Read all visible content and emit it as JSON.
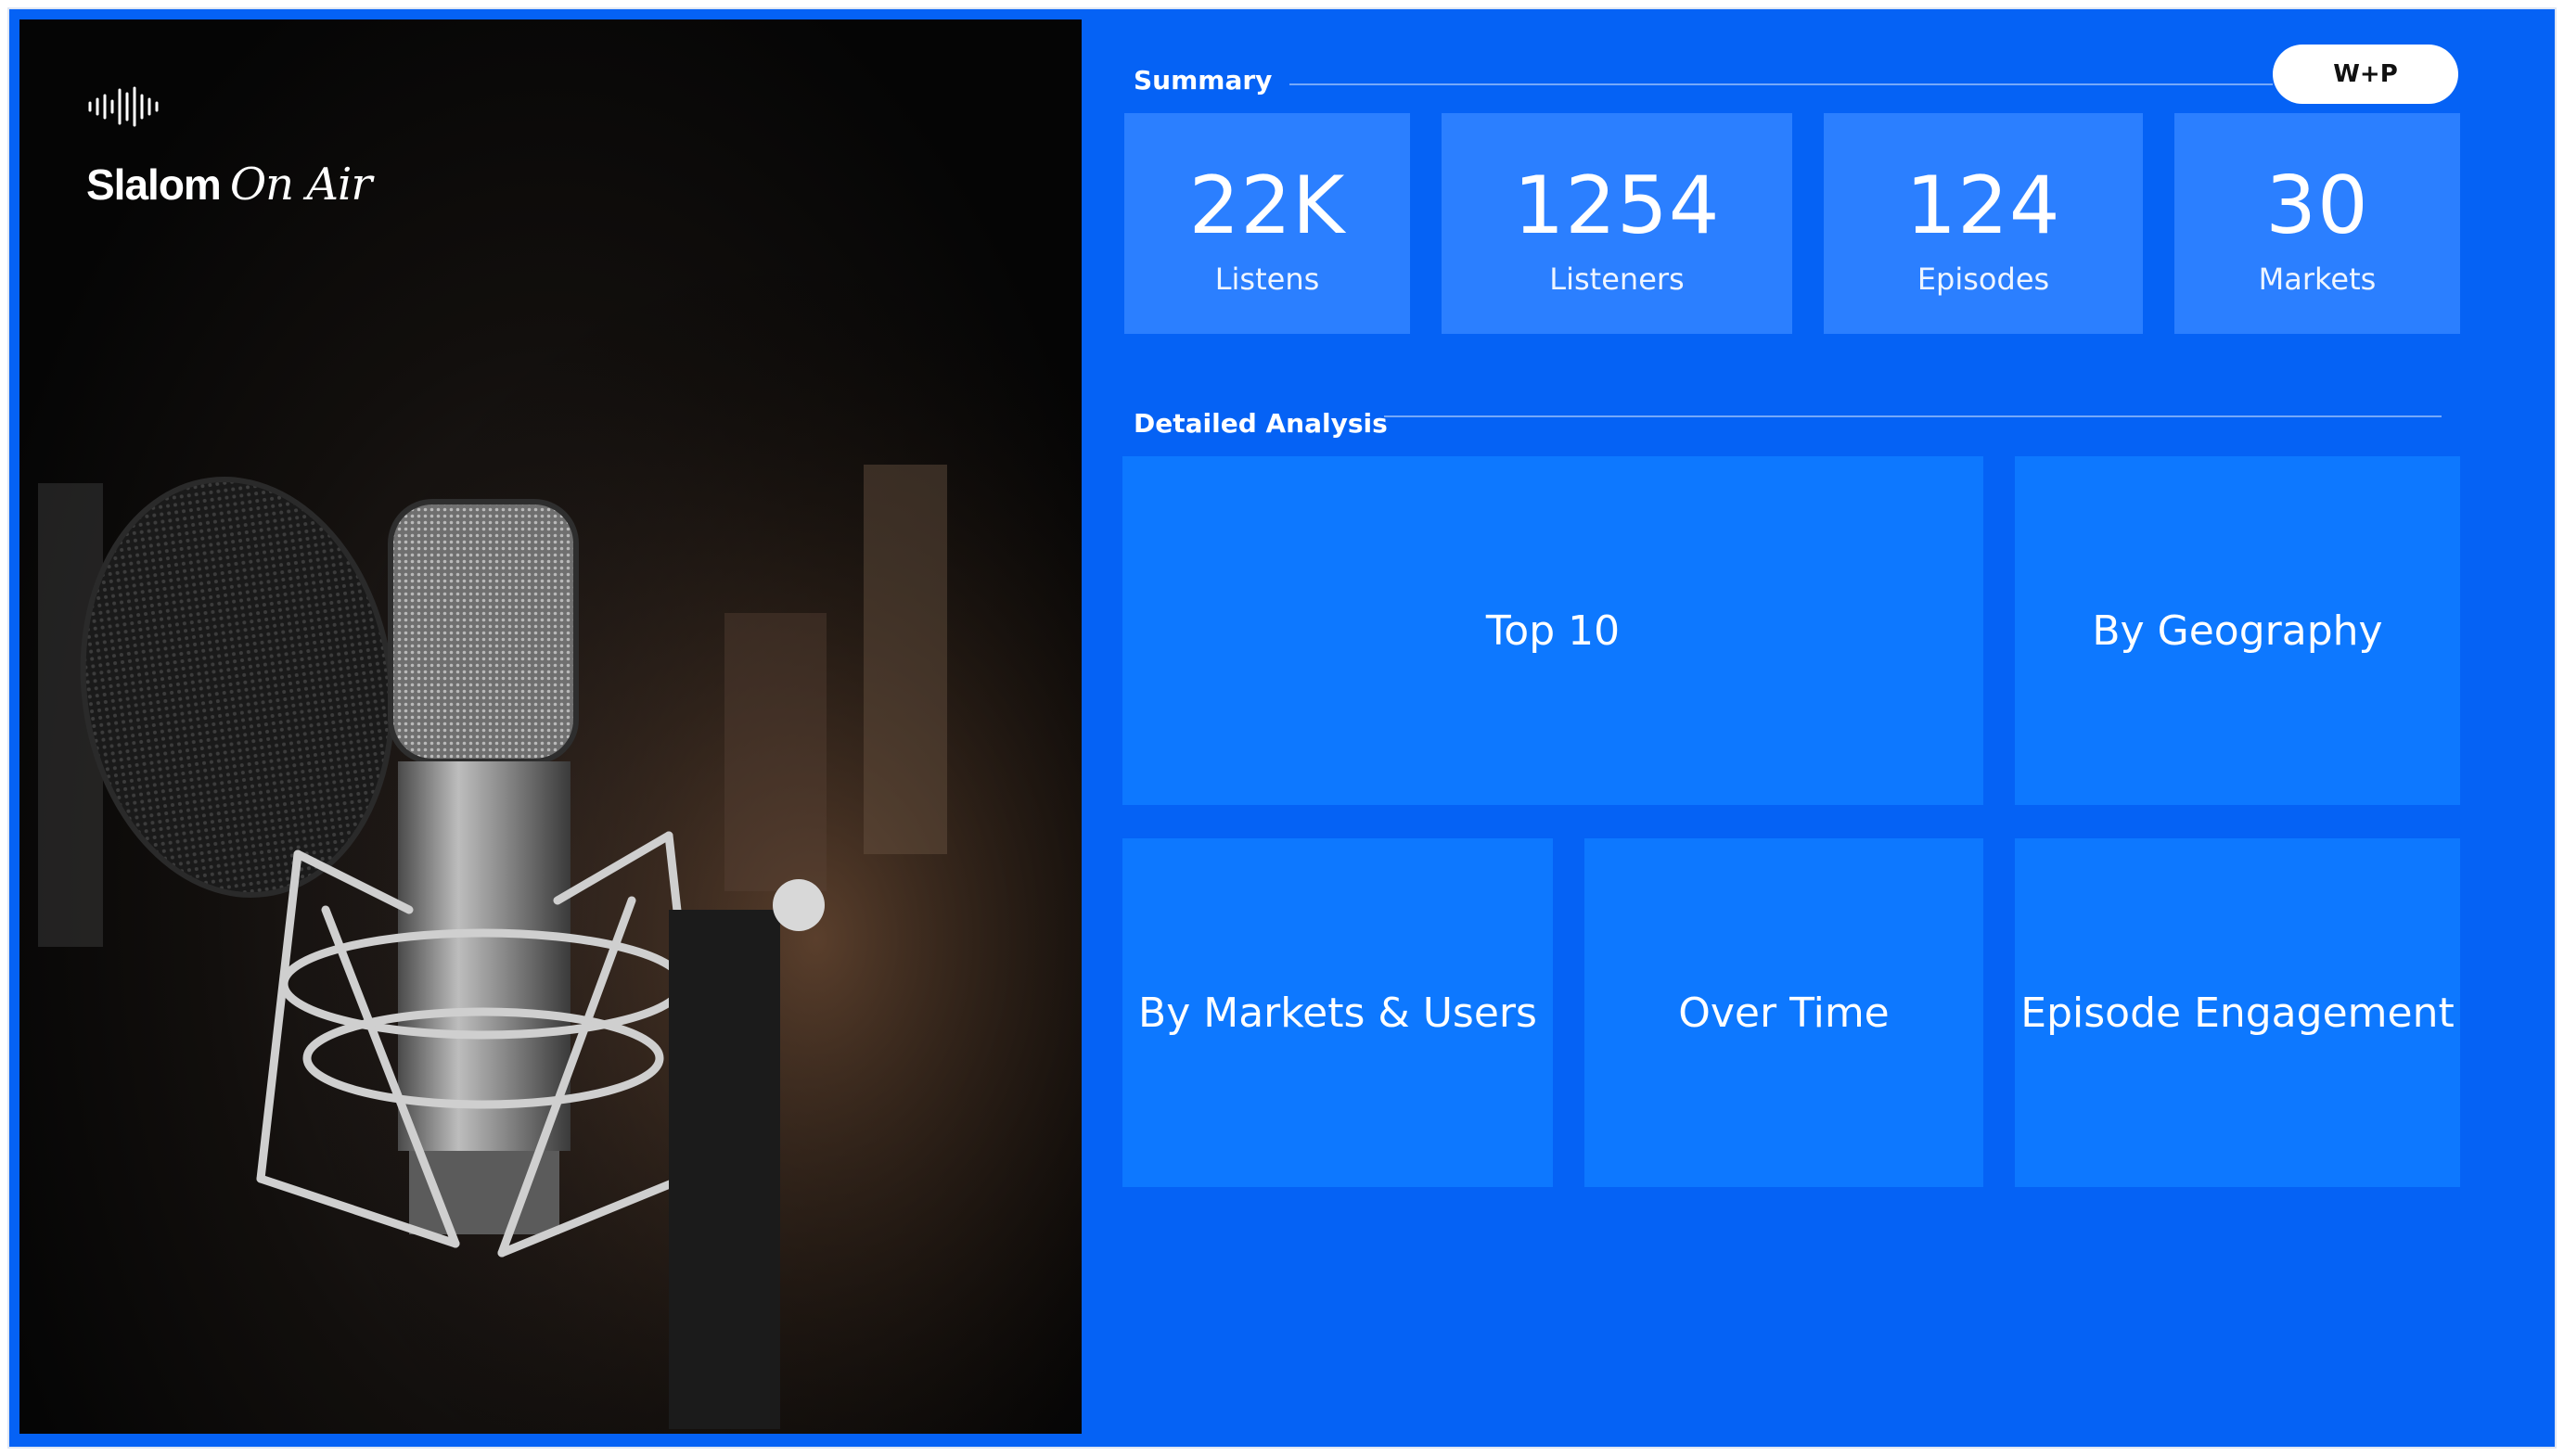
{
  "brand": {
    "name_bold": "Slalom",
    "name_script": "On Air"
  },
  "photo": {
    "subject": "studio-microphone-with-pop-filter"
  },
  "summary": {
    "title": "Summary",
    "badge": "W+P",
    "kpis": [
      {
        "value": "22K",
        "label": "Listens"
      },
      {
        "value": "1254",
        "label": "Listeners"
      },
      {
        "value": "124",
        "label": "Episodes"
      },
      {
        "value": "30",
        "label": "Markets"
      }
    ]
  },
  "analysis": {
    "title": "Detailed Analysis",
    "tiles": {
      "top10": "Top 10",
      "geography": "By Geography",
      "markets_users": "By Markets & Users",
      "over_time": "Over Time",
      "engagement": "Episode Engagement"
    }
  },
  "colors": {
    "background": "#0562f5",
    "kpi_card": "#2b7fff",
    "tile": "#0d78ff",
    "text": "#ffffff"
  }
}
